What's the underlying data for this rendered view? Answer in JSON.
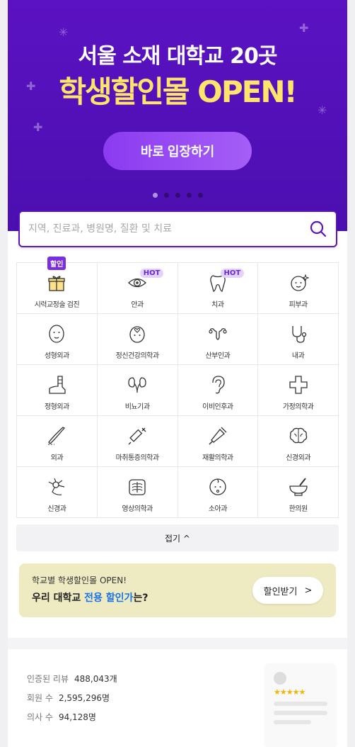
{
  "banner": {
    "line1": "서울 소재 대학교 20곳",
    "line2": "학생할인몰 OPEN!",
    "enter_button": "바로 입장하기",
    "slide_index": 1,
    "slide_count": 5
  },
  "search": {
    "placeholder": "지역, 진료과, 병원명, 질환 및 치료",
    "icon": "search-icon"
  },
  "categories": [
    {
      "label": "시력교정술 검진",
      "icon": "gift-icon",
      "badge": "할인"
    },
    {
      "label": "안과",
      "icon": "eye-icon",
      "badge": "HOT"
    },
    {
      "label": "치과",
      "icon": "tooth-icon",
      "badge": "HOT"
    },
    {
      "label": "피부과",
      "icon": "face-sparkle-icon"
    },
    {
      "label": "성형외과",
      "icon": "face-icon"
    },
    {
      "label": "정신건강의학과",
      "icon": "head-heart-icon"
    },
    {
      "label": "산부인과",
      "icon": "uterus-icon"
    },
    {
      "label": "내과",
      "icon": "stethoscope-icon"
    },
    {
      "label": "정형외과",
      "icon": "cast-icon"
    },
    {
      "label": "비뇨기과",
      "icon": "kidney-icon"
    },
    {
      "label": "이비인후과",
      "icon": "ear-icon"
    },
    {
      "label": "가정의학과",
      "icon": "cross-icon"
    },
    {
      "label": "외과",
      "icon": "scalpel-icon"
    },
    {
      "label": "마취통증의학과",
      "icon": "syringe-icon"
    },
    {
      "label": "재활의학과",
      "icon": "crutch-icon"
    },
    {
      "label": "신경외과",
      "icon": "brain-icon"
    },
    {
      "label": "신경과",
      "icon": "neuron-icon"
    },
    {
      "label": "영상의학과",
      "icon": "xray-icon"
    },
    {
      "label": "소아과",
      "icon": "baby-icon"
    },
    {
      "label": "한의원",
      "icon": "mortar-icon"
    }
  ],
  "collapse": {
    "label": "접기 ^"
  },
  "promo": {
    "line1": "학교별 학생할인몰 OPEN!",
    "line2_a": "우리 대학교 ",
    "line2_highlight": "전용 할인가",
    "line2_b": "는?",
    "button": "할인받기",
    "button_arrow": ">"
  },
  "stats": [
    {
      "key": "인증된 리뷰",
      "value": "488,043개"
    },
    {
      "key": "회원 수",
      "value": "2,595,296명"
    },
    {
      "key": "의사 수",
      "value": "94,128명"
    }
  ],
  "review_card": {
    "stars": "★★★★★"
  },
  "colors": {
    "primary": "#5b12c2",
    "banner_yellow": "#ffe46b",
    "promo_bg": "#eeeac2",
    "highlight": "#1a73e8"
  }
}
